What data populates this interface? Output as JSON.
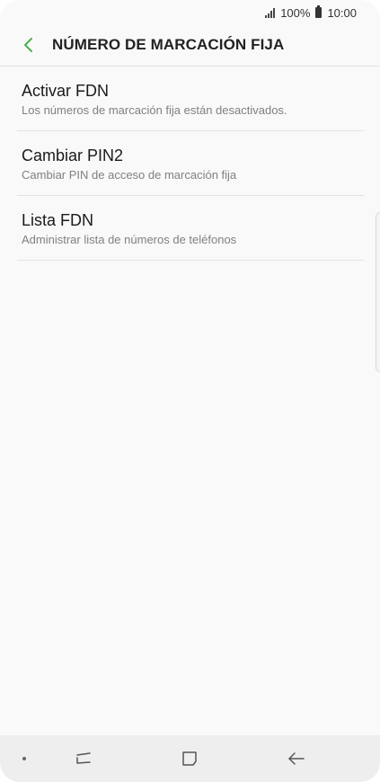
{
  "status_bar": {
    "battery": "100%",
    "time": "10:00"
  },
  "header": {
    "title": "NÚMERO DE MARCACIÓN FIJA",
    "back_icon": "chevron-left-icon",
    "accent_color": "#4caf50"
  },
  "items": [
    {
      "title": "Activar FDN",
      "subtitle": "Los números de marcación fija están desactivados."
    },
    {
      "title": "Cambiar PIN2",
      "subtitle": "Cambiar PIN de acceso de marcación fija"
    },
    {
      "title": "Lista FDN",
      "subtitle": "Administrar lista de números de teléfonos"
    }
  ],
  "nav_bar": {
    "icons": [
      "dot-icon",
      "recent-apps-icon",
      "home-icon",
      "back-arrow-icon"
    ]
  }
}
